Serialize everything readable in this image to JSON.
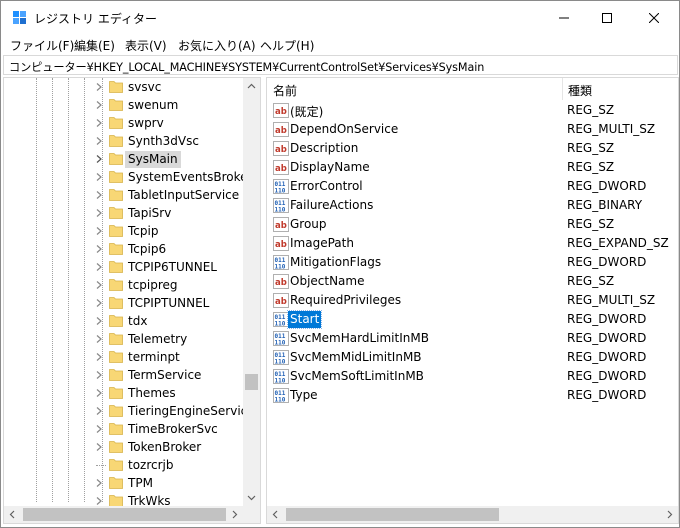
{
  "window": {
    "title": "レジストリ エディター",
    "controls": {
      "minimize": "minimize",
      "maximize": "maximize",
      "close": "close"
    }
  },
  "menu": [
    {
      "label": "ファイル(F)"
    },
    {
      "label": "編集(E)"
    },
    {
      "label": "表示(V)"
    },
    {
      "label": "お気に入り(A)"
    },
    {
      "label": "ヘルプ(H)"
    }
  ],
  "address": {
    "path": "コンピューター¥HKEY_LOCAL_MACHINE¥SYSTEM¥CurrentControlSet¥Services¥SysMain"
  },
  "tree": {
    "selected": "SysMain",
    "items": [
      {
        "label": "svsvc",
        "expandable": true
      },
      {
        "label": "swenum",
        "expandable": true
      },
      {
        "label": "swprv",
        "expandable": true
      },
      {
        "label": "Synth3dVsc",
        "expandable": true
      },
      {
        "label": "SysMain",
        "expandable": true,
        "selected": true
      },
      {
        "label": "SystemEventsBroker",
        "expandable": true
      },
      {
        "label": "TabletInputService",
        "expandable": true
      },
      {
        "label": "TapiSrv",
        "expandable": true
      },
      {
        "label": "Tcpip",
        "expandable": true
      },
      {
        "label": "Tcpip6",
        "expandable": true
      },
      {
        "label": "TCPIP6TUNNEL",
        "expandable": true
      },
      {
        "label": "tcpipreg",
        "expandable": true
      },
      {
        "label": "TCPIPTUNNEL",
        "expandable": true
      },
      {
        "label": "tdx",
        "expandable": true
      },
      {
        "label": "Telemetry",
        "expandable": true
      },
      {
        "label": "terminpt",
        "expandable": true
      },
      {
        "label": "TermService",
        "expandable": true
      },
      {
        "label": "Themes",
        "expandable": true
      },
      {
        "label": "TieringEngineService",
        "expandable": true
      },
      {
        "label": "TimeBrokerSvc",
        "expandable": true
      },
      {
        "label": "TokenBroker",
        "expandable": true
      },
      {
        "label": "tozrcrjb",
        "expandable": false
      },
      {
        "label": "TPM",
        "expandable": true
      },
      {
        "label": "TrkWks",
        "expandable": true
      }
    ]
  },
  "list": {
    "columns": {
      "name": "名前",
      "type": "種類"
    },
    "rows": [
      {
        "name": "(既定)",
        "type": "REG_SZ",
        "icon": "string-value-icon"
      },
      {
        "name": "DependOnService",
        "type": "REG_MULTI_SZ",
        "icon": "string-value-icon"
      },
      {
        "name": "Description",
        "type": "REG_SZ",
        "icon": "string-value-icon"
      },
      {
        "name": "DisplayName",
        "type": "REG_SZ",
        "icon": "string-value-icon"
      },
      {
        "name": "ErrorControl",
        "type": "REG_DWORD",
        "icon": "binary-value-icon"
      },
      {
        "name": "FailureActions",
        "type": "REG_BINARY",
        "icon": "binary-value-icon"
      },
      {
        "name": "Group",
        "type": "REG_SZ",
        "icon": "string-value-icon"
      },
      {
        "name": "ImagePath",
        "type": "REG_EXPAND_SZ",
        "icon": "string-value-icon"
      },
      {
        "name": "MitigationFlags",
        "type": "REG_DWORD",
        "icon": "binary-value-icon"
      },
      {
        "name": "ObjectName",
        "type": "REG_SZ",
        "icon": "string-value-icon"
      },
      {
        "name": "RequiredPrivileges",
        "type": "REG_MULTI_SZ",
        "icon": "string-value-icon"
      },
      {
        "name": "Start",
        "type": "REG_DWORD",
        "icon": "binary-value-icon",
        "selected": true
      },
      {
        "name": "SvcMemHardLimitInMB",
        "type": "REG_DWORD",
        "icon": "binary-value-icon"
      },
      {
        "name": "SvcMemMidLimitInMB",
        "type": "REG_DWORD",
        "icon": "binary-value-icon"
      },
      {
        "name": "SvcMemSoftLimitInMB",
        "type": "REG_DWORD",
        "icon": "binary-value-icon"
      },
      {
        "name": "Type",
        "type": "REG_DWORD",
        "icon": "binary-value-icon"
      }
    ]
  },
  "colors": {
    "selection": "#0078d7",
    "tree_selection": "#d9d9d9",
    "folder": "#f8d775",
    "string_icon": "#c0392b",
    "binary_icon": "#1f5fb4"
  }
}
